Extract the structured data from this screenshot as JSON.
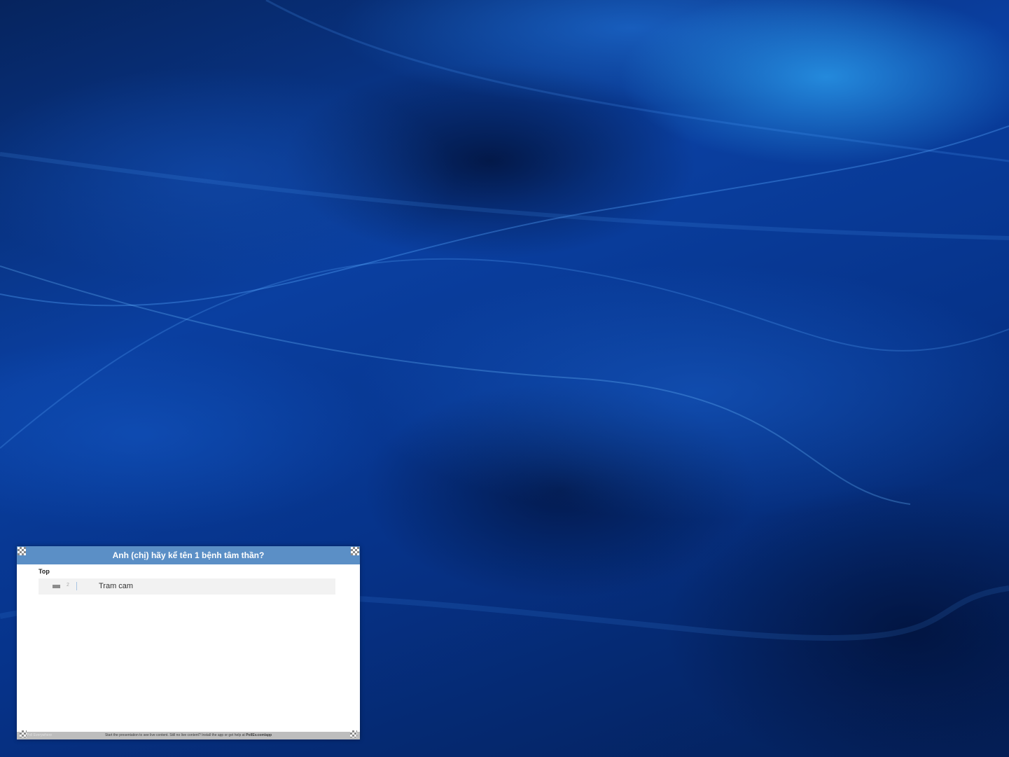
{
  "panel": {
    "question": "Anh (chị) hãy kể tên 1 bệnh tâm thần?",
    "section_label": "Top",
    "answers": [
      {
        "count": "2",
        "text": "Tram cam"
      }
    ],
    "footer": {
      "brand": "Poll Everywhere",
      "text": "Start the presentation to see live content. Still no live content? Install the app or get help at",
      "link": "PollEv.com/app"
    }
  },
  "colors": {
    "header": "#5b8fc6",
    "desktop": "#0a3fa0"
  }
}
